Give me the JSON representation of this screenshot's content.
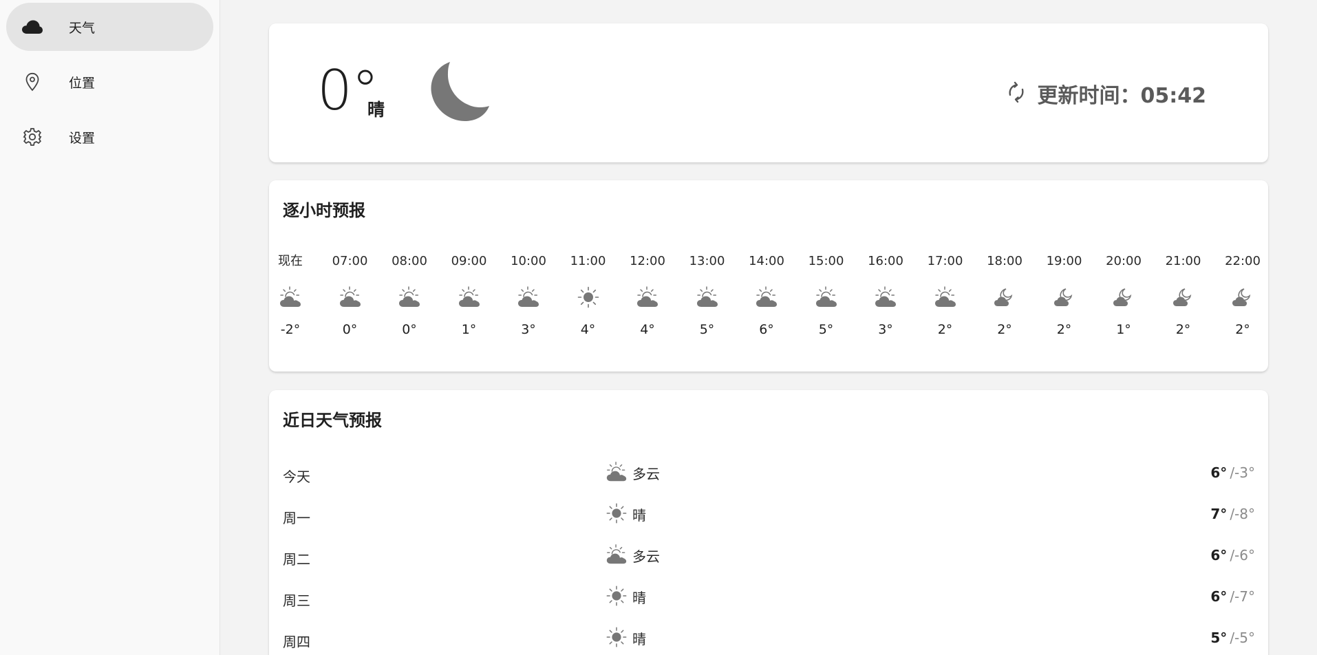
{
  "sidebar": {
    "items": [
      {
        "label": "天气",
        "icon": "cloud-icon",
        "active": true
      },
      {
        "label": "位置",
        "icon": "location-pin-icon",
        "active": false
      },
      {
        "label": "设置",
        "icon": "gear-icon",
        "active": false
      }
    ]
  },
  "current": {
    "temperature": "0°",
    "condition": "晴",
    "icon": "moon-icon",
    "update_label": "更新时间：05:42",
    "update_icon": "refresh-icon"
  },
  "hourly": {
    "title": "逐小时预报",
    "items": [
      {
        "time": "现在",
        "icon": "partly-cloudy-day-icon",
        "temp": "-2°"
      },
      {
        "time": "07:00",
        "icon": "partly-cloudy-day-icon",
        "temp": "0°"
      },
      {
        "time": "08:00",
        "icon": "partly-cloudy-day-icon",
        "temp": "0°"
      },
      {
        "time": "09:00",
        "icon": "partly-cloudy-day-icon",
        "temp": "1°"
      },
      {
        "time": "10:00",
        "icon": "partly-cloudy-day-icon",
        "temp": "3°"
      },
      {
        "time": "11:00",
        "icon": "sun-icon",
        "temp": "4°"
      },
      {
        "time": "12:00",
        "icon": "partly-cloudy-day-icon",
        "temp": "4°"
      },
      {
        "time": "13:00",
        "icon": "partly-cloudy-day-icon",
        "temp": "5°"
      },
      {
        "time": "14:00",
        "icon": "partly-cloudy-day-icon",
        "temp": "6°"
      },
      {
        "time": "15:00",
        "icon": "partly-cloudy-day-icon",
        "temp": "5°"
      },
      {
        "time": "16:00",
        "icon": "partly-cloudy-day-icon",
        "temp": "3°"
      },
      {
        "time": "17:00",
        "icon": "partly-cloudy-day-icon",
        "temp": "2°"
      },
      {
        "time": "18:00",
        "icon": "partly-cloudy-night-icon",
        "temp": "2°"
      },
      {
        "time": "19:00",
        "icon": "partly-cloudy-night-icon",
        "temp": "2°"
      },
      {
        "time": "20:00",
        "icon": "partly-cloudy-night-icon",
        "temp": "1°"
      },
      {
        "time": "21:00",
        "icon": "partly-cloudy-night-icon",
        "temp": "2°"
      },
      {
        "time": "22:00",
        "icon": "partly-cloudy-night-icon",
        "temp": "2°"
      }
    ]
  },
  "daily": {
    "title": "近日天气预报",
    "items": [
      {
        "day": "今天",
        "icon": "partly-cloudy-day-icon",
        "condition": "多云",
        "high": "6°",
        "low": "/-3°"
      },
      {
        "day": "周一",
        "icon": "sun-icon",
        "condition": "晴",
        "high": "7°",
        "low": "/-8°"
      },
      {
        "day": "周二",
        "icon": "partly-cloudy-day-icon",
        "condition": "多云",
        "high": "6°",
        "low": "/-6°"
      },
      {
        "day": "周三",
        "icon": "sun-icon",
        "condition": "晴",
        "high": "6°",
        "low": "/-7°"
      },
      {
        "day": "周四",
        "icon": "sun-icon",
        "condition": "晴",
        "high": "5°",
        "low": "/-5°"
      }
    ]
  },
  "colors": {
    "background": "#f3f3f3",
    "sidebar_active": "#e4e4e4",
    "card": "#ffffff",
    "icon_gray": "#777777"
  }
}
